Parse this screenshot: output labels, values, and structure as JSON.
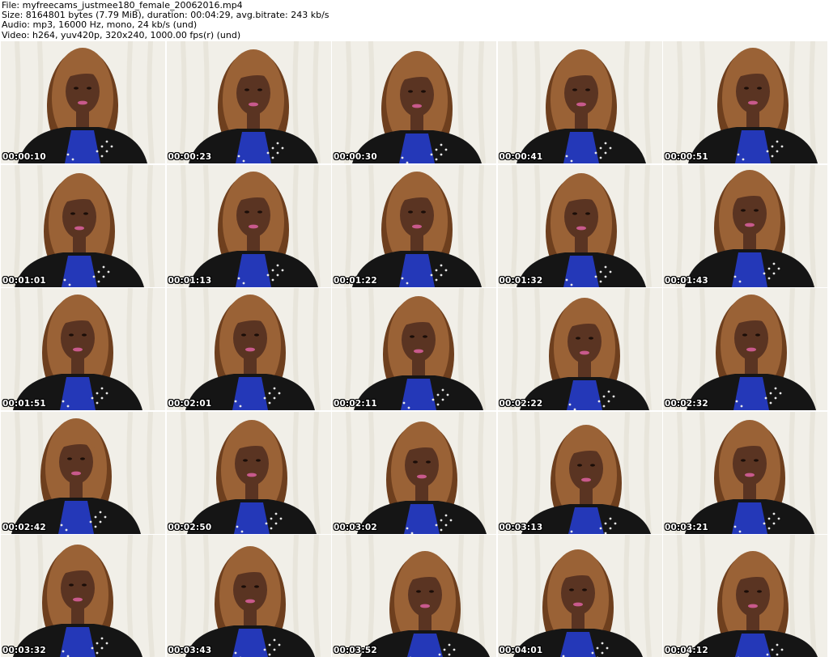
{
  "header": {
    "file": "File: myfreecams_justmee180_female_20062016.mp4",
    "size": "Size: 8164801 bytes (7.79 MiB), duration: 00:04:29, avg.bitrate: 243 kb/s",
    "audio": "Audio: mp3, 16000 Hz, mono, 24 kb/s (und)",
    "video": "Video: h264, yuv420p, 320x240, 1000.00 fps(r) (und)"
  },
  "frames": [
    {
      "time": "00:00:10"
    },
    {
      "time": "00:00:23"
    },
    {
      "time": "00:00:30"
    },
    {
      "time": "00:00:41"
    },
    {
      "time": "00:00:51"
    },
    {
      "time": "00:01:01"
    },
    {
      "time": "00:01:13"
    },
    {
      "time": "00:01:22"
    },
    {
      "time": "00:01:32"
    },
    {
      "time": "00:01:43"
    },
    {
      "time": "00:01:51"
    },
    {
      "time": "00:02:01"
    },
    {
      "time": "00:02:11"
    },
    {
      "time": "00:02:22"
    },
    {
      "time": "00:02:32"
    },
    {
      "time": "00:02:42"
    },
    {
      "time": "00:02:50"
    },
    {
      "time": "00:03:02"
    },
    {
      "time": "00:03:13"
    },
    {
      "time": "00:03:21"
    },
    {
      "time": "00:03:32"
    },
    {
      "time": "00:03:43"
    },
    {
      "time": "00:03:52"
    },
    {
      "time": "00:04:01"
    },
    {
      "time": "00:04:12"
    }
  ],
  "colors": {
    "background": "#f1efe8",
    "curtain": "#e4e1d6",
    "hair": "#9a6236",
    "hair_dark": "#6e3f1e",
    "skin": "#5a3422",
    "jacket": "#151515",
    "top": "#2438b8",
    "studs": "#e8e8e8",
    "lips": "#c85a8c",
    "timestamp": "#ffffff"
  }
}
